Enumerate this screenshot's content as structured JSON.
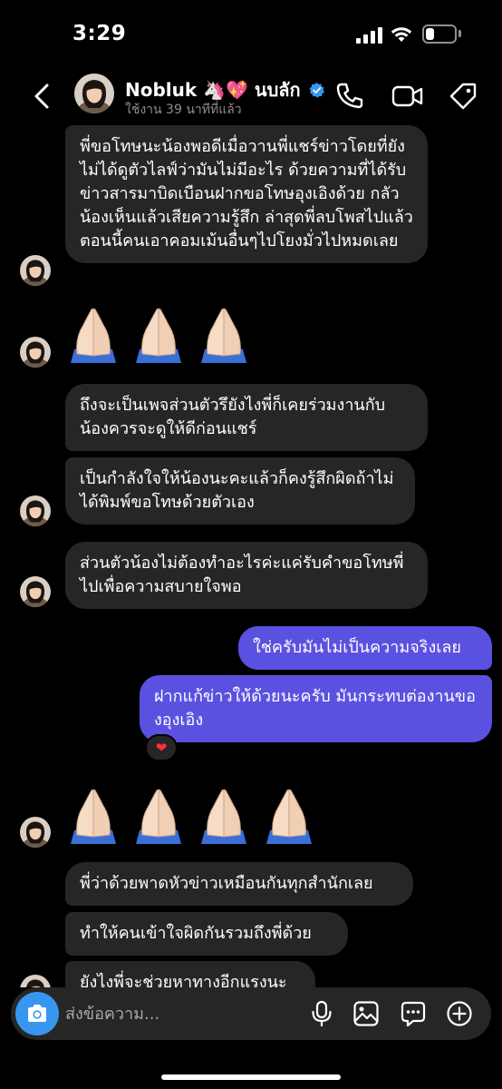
{
  "status_bar": {
    "time": "3:29",
    "battery_level": 0.3
  },
  "header": {
    "name": "Nobluk 🦄💖 นบลัก",
    "status": "ใช้งาน 39 นาทีที่แล้ว",
    "icons": [
      "back-arrow",
      "phone",
      "video-camera",
      "tag"
    ]
  },
  "messages": [
    {
      "from": "them",
      "text": "พี่ขอโทษนะน้องพอดีเมื่อวานพี่แชร์ข่าวโดยที่ยังไม่ได้ดูตัวไลฟ์ว่ามันไม่มีอะไร ด้วยความที่ได้รับข่าวสารมาบิดเบือนฝากขอโทษอุงเอิงด้วย กลัวน้องเห็นแล้วเสียความรู้สึก ล่าสุดพี่ลบโพสไปแล้ว ตอนนี้คนเอาคอมเม้นอื่นๆไปโยงมั่วไปหมดเลย"
    },
    {
      "from": "them",
      "text": "🙏🏻🙏🏻🙏🏻"
    },
    {
      "from": "them",
      "text": "ถึงจะเป็นเพจส่วนตัวรึยังไงพี่ก็เคยร่วมงานกับน้องควรจะดูให้ดีก่อนแชร์"
    },
    {
      "from": "them",
      "text": "เป็นกำลังใจให้น้องนะคะแล้วก็คงรู้สึกผิดถ้าไม่ได้พิมพ์ขอโทษด้วยตัวเอง"
    },
    {
      "from": "them",
      "text": "ส่วนตัวน้องไม่ต้องทำอะไรค่ะแค่รับคำขอโทษพี่ไปเพื่อความสบายใจพอ"
    },
    {
      "from": "me",
      "text": "ใช่ครับมันไม่เป็นความจริงเลย"
    },
    {
      "from": "me",
      "text": "ฝากแก้ข่าวให้ด้วยนะครับ มันกระทบต่องานของอุงเอิง",
      "reaction": "❤"
    },
    {
      "from": "them",
      "text": "🙏🏻🙏🏻🙏🏻🙏🏻"
    },
    {
      "from": "them",
      "text": "พี่ว่าด้วยพาดหัวข่าวเหมือนกันทุกสำนักเลย"
    },
    {
      "from": "them",
      "text": "ทำให้คนเข้าใจผิดกันรวมถึงพี่ด้วย"
    },
    {
      "from": "them",
      "text": "ยังไงพี่จะช่วยหาทางอีกแรงนะ"
    }
  ],
  "composer": {
    "placeholder": "ส่งข้อความ...",
    "icons": [
      "camera",
      "microphone",
      "gallery",
      "sticker",
      "add"
    ]
  },
  "colors": {
    "outgoing_bubble": "#5b51e1",
    "incoming_bubble": "#262626",
    "accent": "#3797f0"
  }
}
